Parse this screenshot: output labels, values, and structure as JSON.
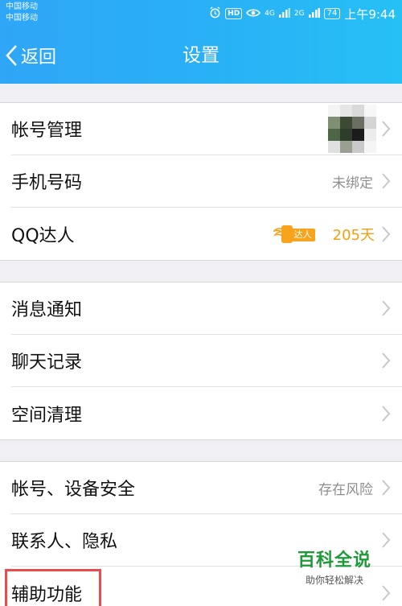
{
  "status_bar": {
    "carrier1": "中国移动",
    "carrier2": "中国移动",
    "hd": "HD",
    "sig1": "4G",
    "sig2": "2G",
    "battery": "74",
    "time": "上午9:44"
  },
  "nav": {
    "back_label": "返回",
    "title": "设置"
  },
  "groups": [
    {
      "rows": [
        {
          "label": "帐号管理",
          "value": "",
          "avatar": true
        },
        {
          "label": "手机号码",
          "value": "未绑定"
        },
        {
          "label": "QQ达人",
          "value": "",
          "daren_tag": "达人",
          "daren_days": "205天"
        }
      ]
    },
    {
      "rows": [
        {
          "label": "消息通知",
          "value": ""
        },
        {
          "label": "聊天记录",
          "value": ""
        },
        {
          "label": "空间清理",
          "value": ""
        }
      ]
    },
    {
      "rows": [
        {
          "label": "帐号、设备安全",
          "value": "存在风险"
        },
        {
          "label": "联系人、隐私",
          "value": ""
        },
        {
          "label": "辅助功能",
          "value": ""
        }
      ]
    }
  ],
  "watermark": {
    "title": "百科全说",
    "subtitle": "助你轻松解决"
  },
  "colors": {
    "nav_gradient_start": "#2fa6f6",
    "nav_gradient_end": "#26c0f5",
    "highlight_border": "#e84c4c",
    "daren_orange": "#f7a31b",
    "watermark_green": "#1f9a3a"
  }
}
